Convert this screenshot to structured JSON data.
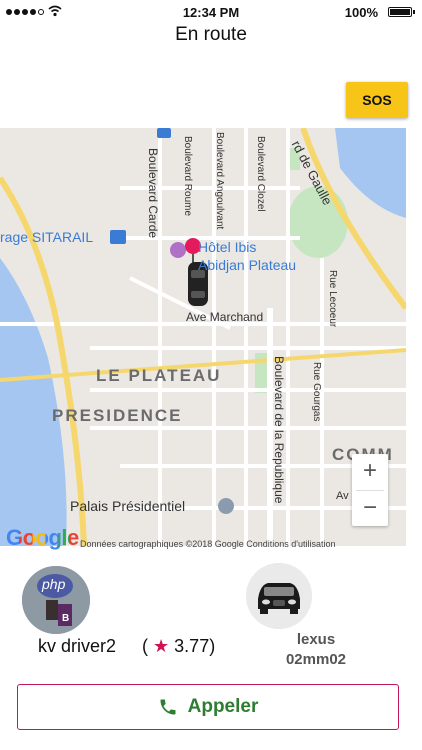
{
  "status_bar": {
    "signal_icon": "signal-dots-icon",
    "wifi_icon": "wifi-icon",
    "time": "12:34 PM",
    "battery_percent": "100%",
    "battery_icon": "battery-icon",
    "battery_level": 1.0
  },
  "header": {
    "title": "En route",
    "sos_label": "SOS",
    "sos_color": "#f7c418"
  },
  "map": {
    "labels": {
      "sitarail": "rage SITARAIL",
      "hotel_line1": "Hôtel Ibis",
      "hotel_line2": "Abidjan Plateau",
      "ave_marchand": "Ave Marchand",
      "le_plateau": "LE PLATEAU",
      "presidence": "PRESIDENCE",
      "palais": "Palais Présidentiel",
      "comm": "COMM",
      "av": "Av",
      "bd_carde": "Boulevard Carde",
      "bd_roume": "Boulevard Roume",
      "bd_angoulvant": "Boulevard Angoulvant",
      "bd_clozel": "Boulevard Clozel",
      "de_gaulle": "rd de Gaulle",
      "rue_lecoeur": "Rue Lecoeur",
      "rue_gourgas": "Rue Gourgas",
      "bd_republique": "Boulevard de la Republique"
    },
    "zoom_in": "+",
    "zoom_out": "−",
    "google_logo": "Google",
    "attribution": "Données cartographiques ©2018 Google   Conditions d'utilisation"
  },
  "driver": {
    "avatar_text": "php",
    "name": "kv driver2",
    "rating_prefix": "(",
    "rating_value": "3.77)",
    "star_icon": "star-icon",
    "star_color": "#d0134f"
  },
  "vehicle": {
    "model": "lexus",
    "plate": "02mm02",
    "car_icon": "car-front-icon"
  },
  "call_button": {
    "label": "Appeler",
    "icon": "phone-icon",
    "label_color": "#2e7d32",
    "border_color": "#c2185b"
  }
}
